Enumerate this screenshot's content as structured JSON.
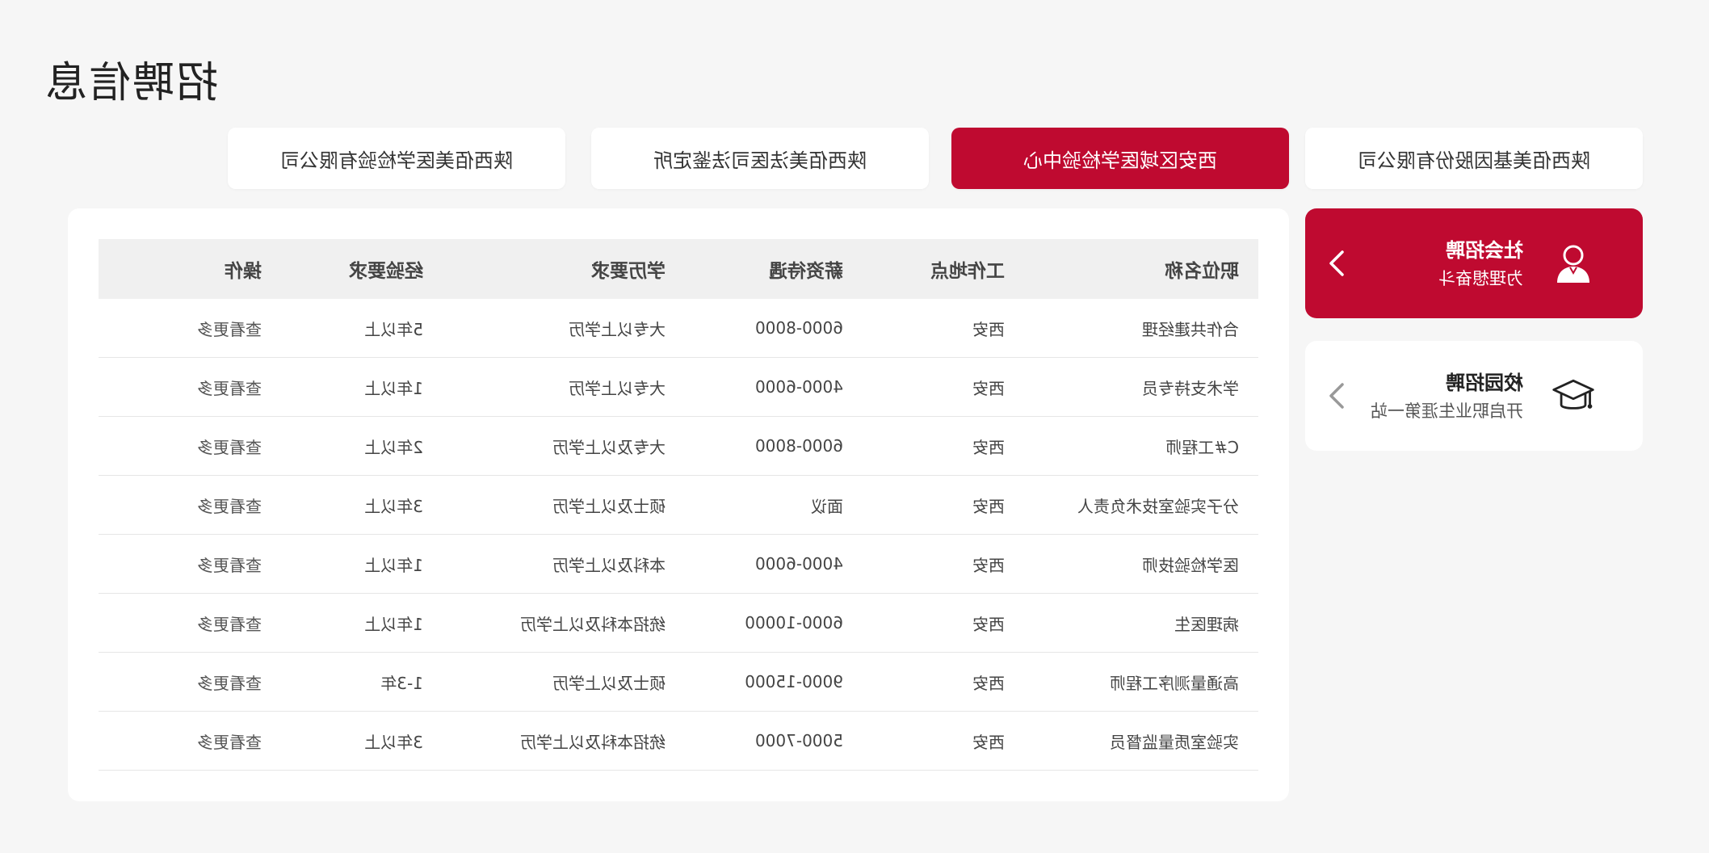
{
  "page": {
    "title": "招聘信息"
  },
  "company_tabs": [
    {
      "label": "陕西佰美基因股份有限公司",
      "active": false
    },
    {
      "label": "西安区域医学检验中心",
      "active": true
    },
    {
      "label": "陕西佰美法医司法鉴定所",
      "active": false
    },
    {
      "label": "陕西佰美医学检验有限公司",
      "active": false
    }
  ],
  "side_nav": [
    {
      "name": "社会招聘",
      "desc": "为理想奋斗",
      "icon": "person-icon",
      "active": true
    },
    {
      "name": "校园招聘",
      "desc": "开启职业生涯第一站",
      "icon": "graduation-cap-icon",
      "active": false
    }
  ],
  "table": {
    "headers": [
      "职位名称",
      "工作地点",
      "薪资待遇",
      "学历要求",
      "经验要求",
      "操作"
    ],
    "rows": [
      [
        "合作共建经理",
        "西安",
        "6000-8000",
        "大专以上学历",
        "5年以上",
        "查看更多"
      ],
      [
        "学术支持专员",
        "西安",
        "4000-6000",
        "大专以上学历",
        "1年以上",
        "查看更多"
      ],
      [
        "C#工程师",
        "西安",
        "6000-8000",
        "大专及以上学历",
        "2年以上",
        "查看更多"
      ],
      [
        "分子实验室技术负责人",
        "西安",
        "面议",
        "硕士及以上学历",
        "3年以上",
        "查看更多"
      ],
      [
        "医学检验技师",
        "西安",
        "4000-6000",
        "本科及以上学历",
        "1年以上",
        "查看更多"
      ],
      [
        "病理医生",
        "西安",
        "6000-10000",
        "统招本科及以上学历",
        "1年以上",
        "查看更多"
      ],
      [
        "高通量测序工程师",
        "西安",
        "9000-15000",
        "硕士及以上学历",
        "1-3年",
        "查看更多"
      ],
      [
        "实验室质量监督员",
        "西安",
        "5000-7000",
        "统招本科及以上学历",
        "3年以上",
        "查看更多"
      ]
    ]
  },
  "colors": {
    "accent": "#bf0a30",
    "background": "#f6f6f6"
  }
}
